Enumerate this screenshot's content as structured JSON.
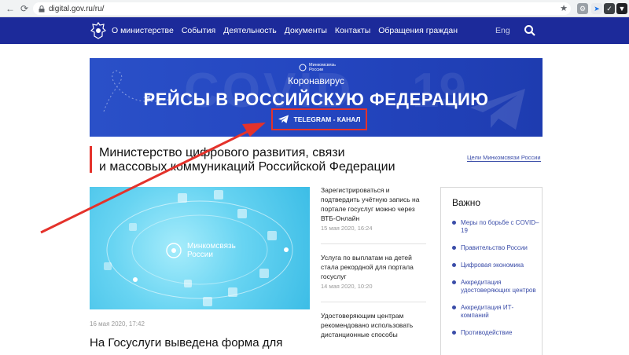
{
  "browser": {
    "url": "digital.gov.ru/ru/",
    "star_icon": "★"
  },
  "header": {
    "menu": [
      {
        "id": "about",
        "label": "О министерстве"
      },
      {
        "id": "events",
        "label": "События"
      },
      {
        "id": "activity",
        "label": "Деятельность"
      },
      {
        "id": "documents",
        "label": "Документы"
      },
      {
        "id": "contacts",
        "label": "Контакты"
      },
      {
        "id": "appeals",
        "label": "Обращения граждан"
      }
    ],
    "lang": "Eng"
  },
  "banner": {
    "logo_line1": "Минкомсвязь",
    "logo_line2": "России",
    "bg_text_left": "COVID",
    "bg_text_right": "19",
    "subtitle": "Коронавирус",
    "title": "РЕЙСЫ В РОССИЙСКУЮ ФЕДЕРАЦИЮ",
    "button": "TELEGRAM - КАНАЛ"
  },
  "page": {
    "title_line1": "Министерство цифрового развития, связи",
    "title_line2": "и массовых коммуникаций Российской Федерации",
    "goals_link": "Цели Минкомсвязи России"
  },
  "feature": {
    "logo_line1": "Минкомсвязь",
    "logo_line2": "России",
    "date": "16 мая 2020, 17:42",
    "headline": "На Госуслуги выведена форма для"
  },
  "news": [
    {
      "title": "Зарегистрироваться и подтвердить учётную запись на портале госуслуг можно через ВТБ-Онлайн",
      "date": "15 мая 2020, 16:24"
    },
    {
      "title": "Услуга по выплатам на детей стала рекордной для портала госуслуг",
      "date": "14 мая 2020, 10:20"
    },
    {
      "title": "Удостоверяющим центрам рекомендовано использовать дистанционные способы",
      "date": ""
    }
  ],
  "important": {
    "title": "Важно",
    "items": [
      "Меры по борьбе с COVID–19",
      "Правительство России",
      "Цифровая экономика",
      "Аккредитация удостоверяющих центров",
      "Аккредитация ИТ-компаний",
      "Противодействие"
    ]
  },
  "colors": {
    "header_bg": "#1c2a9a",
    "banner_bg": "#2446c0",
    "accent_red": "#e4322b",
    "link_blue": "#3a4ca8"
  }
}
